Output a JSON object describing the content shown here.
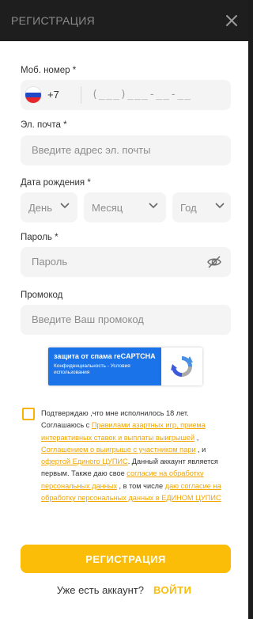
{
  "header": {
    "title": "РЕГИСТРАЦИЯ",
    "close_icon": "close-icon"
  },
  "phone": {
    "label": "Моб. номер *",
    "country_code": "+7",
    "mask": "(___)___-__-__",
    "flag_icon": "russia-flag-icon"
  },
  "email": {
    "label": "Эл. почта *",
    "placeholder": "Введите адрес эл. почты"
  },
  "birthdate": {
    "label": "Дата рождения *",
    "day": "День",
    "month": "Месяц",
    "year": "Год",
    "chevron_icon": "chevron-down-icon"
  },
  "password": {
    "label": "Пароль *",
    "placeholder": "Пароль",
    "toggle_icon": "eye-off-icon"
  },
  "promo": {
    "label": "Промокод",
    "placeholder": "Введите Ваш промокод"
  },
  "recaptcha": {
    "title": "защита от спама reCAPTCHA",
    "subtitle": "Конфиденциальность - Условия использования",
    "logo_icon": "recaptcha-logo-icon"
  },
  "consent": {
    "t1": "Подтверждаю ,что мне исполнилось 18 лет. Соглашаюсь с ",
    "link1": "Правилами азартных игр, приема интерактивных ставок и выплаты выигрышей",
    "t2": " , ",
    "link2": "Соглашением о выигрыше с участником пари",
    "t3": " , и ",
    "link3": "офертой Единого ЦУПИС",
    "t4": ". Данный аккаунт является первым. Также даю свое ",
    "link4": "согласие на обработку персональных данных",
    "t5": " , в том числе ",
    "link5": "даю согласие на обработку персональных данных в ЕДИНОМ ЦУПИС",
    "accent_color": "#f7b500"
  },
  "actions": {
    "register": "РЕГИСТРАЦИЯ",
    "have_account": "Уже есть аккаунт?",
    "login": "ВОЙТИ"
  },
  "colors": {
    "accent": "#fbbd08",
    "header_bg": "#1e1e1e",
    "field_bg": "#f4f4f4",
    "captcha_blue": "#1a73e8"
  }
}
